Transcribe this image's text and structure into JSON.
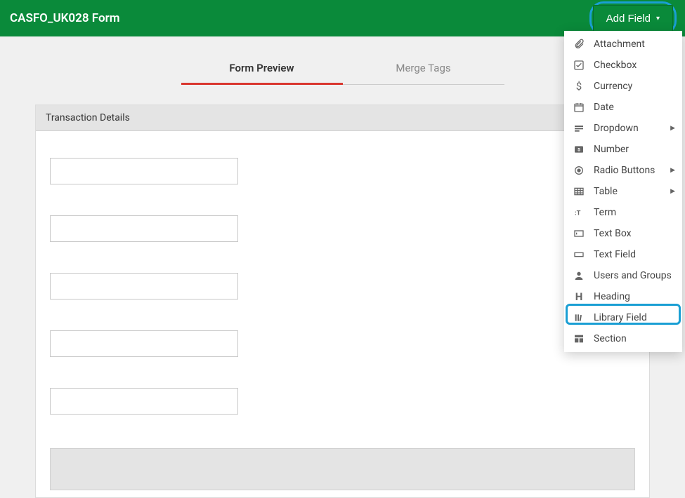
{
  "header": {
    "title": "CASFO_UK028 Form",
    "add_field_label": "Add Field"
  },
  "tabs": {
    "preview": "Form Preview",
    "merge": "Merge Tags"
  },
  "section": {
    "title": "Transaction Details"
  },
  "fields": {
    "f1": "",
    "f2": "",
    "f3": "",
    "f4": "",
    "f5": ""
  },
  "menu": {
    "attachment": "Attachment",
    "checkbox": "Checkbox",
    "currency": "Currency",
    "date": "Date",
    "dropdown": "Dropdown",
    "number": "Number",
    "radio": "Radio Buttons",
    "table": "Table",
    "term": "Term",
    "textbox": "Text Box",
    "textfield": "Text Field",
    "usersgroups": "Users and Groups",
    "heading": "Heading",
    "library": "Library Field",
    "section": "Section"
  }
}
